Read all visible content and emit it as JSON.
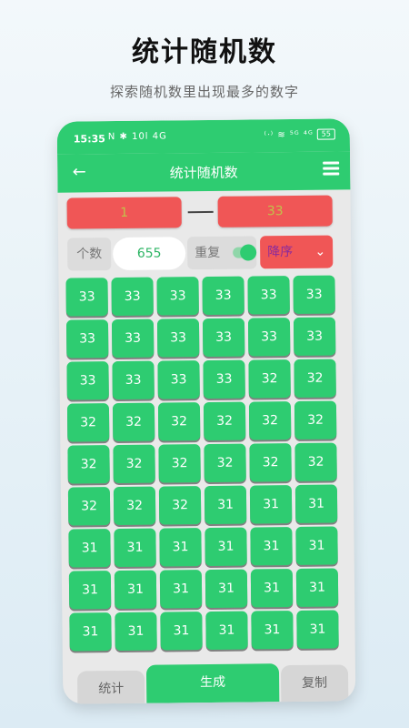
{
  "promo": {
    "title": "统计随机数",
    "subtitle": "探索随机数里出现最多的数字"
  },
  "statusbar": {
    "time": "15:35",
    "left_icons": "N ✱ 10l 4G",
    "right_icons": "⁽ᐧ⁾ ≋ ⁵ᴳ ⁴ᴳ",
    "battery": "55"
  },
  "appbar": {
    "title": "统计随机数",
    "back_icon": "arrow-left-icon",
    "menu_icon": "hamburger-menu-icon"
  },
  "range": {
    "min": "1",
    "max": "33"
  },
  "options": {
    "count_label": "个数",
    "count_value": "655",
    "repeat_label": "重复",
    "repeat_enabled": true,
    "sort_value": "降序",
    "sort_chevron": "⌄"
  },
  "results": [
    "33",
    "33",
    "33",
    "33",
    "33",
    "33",
    "33",
    "33",
    "33",
    "33",
    "33",
    "33",
    "33",
    "33",
    "33",
    "33",
    "32",
    "32",
    "32",
    "32",
    "32",
    "32",
    "32",
    "32",
    "32",
    "32",
    "32",
    "32",
    "32",
    "32",
    "32",
    "32",
    "32",
    "31",
    "31",
    "31",
    "31",
    "31",
    "31",
    "31",
    "31",
    "31",
    "31",
    "31",
    "31",
    "31",
    "31",
    "31",
    "31",
    "31",
    "31",
    "31",
    "31",
    "31"
  ],
  "bottom": {
    "stats_label": "统计",
    "generate_label": "生成",
    "copy_label": "复制"
  },
  "colors": {
    "primary_green": "#2ecc71",
    "range_red": "#f05656",
    "sort_text_purple": "#8a2a9c"
  }
}
